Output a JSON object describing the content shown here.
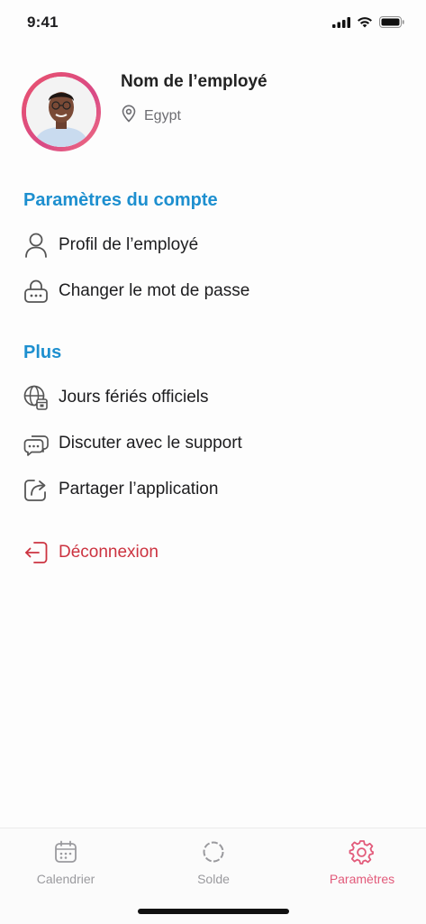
{
  "status_bar": {
    "time": "9:41"
  },
  "profile": {
    "name": "Nom de l’employé",
    "country": "Egypt"
  },
  "account_section": {
    "title": "Paramètres du compte",
    "items": [
      {
        "label": "Profil de l’employé",
        "icon": "person-icon"
      },
      {
        "label": "Changer le mot de passe",
        "icon": "lock-icon"
      }
    ]
  },
  "more_section": {
    "title": "Plus",
    "items": [
      {
        "label": "Jours fériés officiels",
        "icon": "globe-calendar-icon"
      },
      {
        "label": "Discuter avec le support",
        "icon": "chat-bubbles-icon"
      },
      {
        "label": "Partager l’application",
        "icon": "share-icon"
      }
    ]
  },
  "logout": {
    "label": "Déconnexion",
    "icon": "logout-icon"
  },
  "tabbar": {
    "tabs": [
      {
        "label": "Calendrier",
        "icon": "calendar-icon",
        "active": false
      },
      {
        "label": "Solde",
        "icon": "balance-ring-icon",
        "active": false
      },
      {
        "label": "Paramètres",
        "icon": "gear-icon",
        "active": true
      }
    ]
  },
  "colors": {
    "accent": "#1d8fcf",
    "danger": "#cc3340",
    "active_tab": "#e25a7a",
    "avatar_ring": "#e9536d"
  }
}
